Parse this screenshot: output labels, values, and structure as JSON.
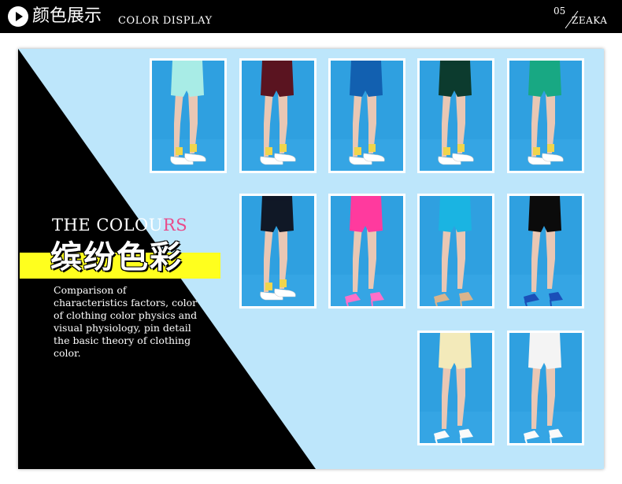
{
  "header": {
    "title_cn": "颜色展示",
    "title_en": "COLOR DISPLAY",
    "page_number": "05",
    "brand": "ZEAKA",
    "icon": "play-circle-icon"
  },
  "intro": {
    "heading_en_part1": "THE COLOU",
    "heading_en_part2": "RS",
    "heading_cn": "缤纷色彩",
    "description": "Comparison of characteristics factors, color of clothing color physics and visual physiology, pin detail the basic theory of clothing color."
  },
  "colors": {
    "header_bg": "#000000",
    "panel_bg": "#bde6fb",
    "triangle": "#000000",
    "accent_yellow": "#ffff1e",
    "accent_pink": "#e94b8a",
    "photo_bg": "#2fa0e0"
  },
  "swatches": [
    {
      "shorts": "#a8ece6",
      "shoe": "white-sneaker"
    },
    {
      "shorts": "#5a1420",
      "shoe": "white-sneaker"
    },
    {
      "shorts": "#1260b0",
      "shoe": "white-sneaker"
    },
    {
      "shorts": "#0c3b2e",
      "shoe": "white-sneaker"
    },
    {
      "shorts": "#18a883",
      "shoe": "white-sneaker"
    },
    {
      "shorts": "#101826",
      "shoe": "white-sneaker"
    },
    {
      "shorts": "#ff3a9e",
      "shoe": "pink-heel"
    },
    {
      "shorts": "#1ab4e2",
      "shoe": "beige-sandal"
    },
    {
      "shorts": "#0b0b0b",
      "shoe": "blue-wedge"
    },
    {
      "shorts": "#f3eaba",
      "shoe": "white-heel"
    },
    {
      "shorts": "#f4f4f4",
      "shoe": "white-loafer"
    }
  ]
}
